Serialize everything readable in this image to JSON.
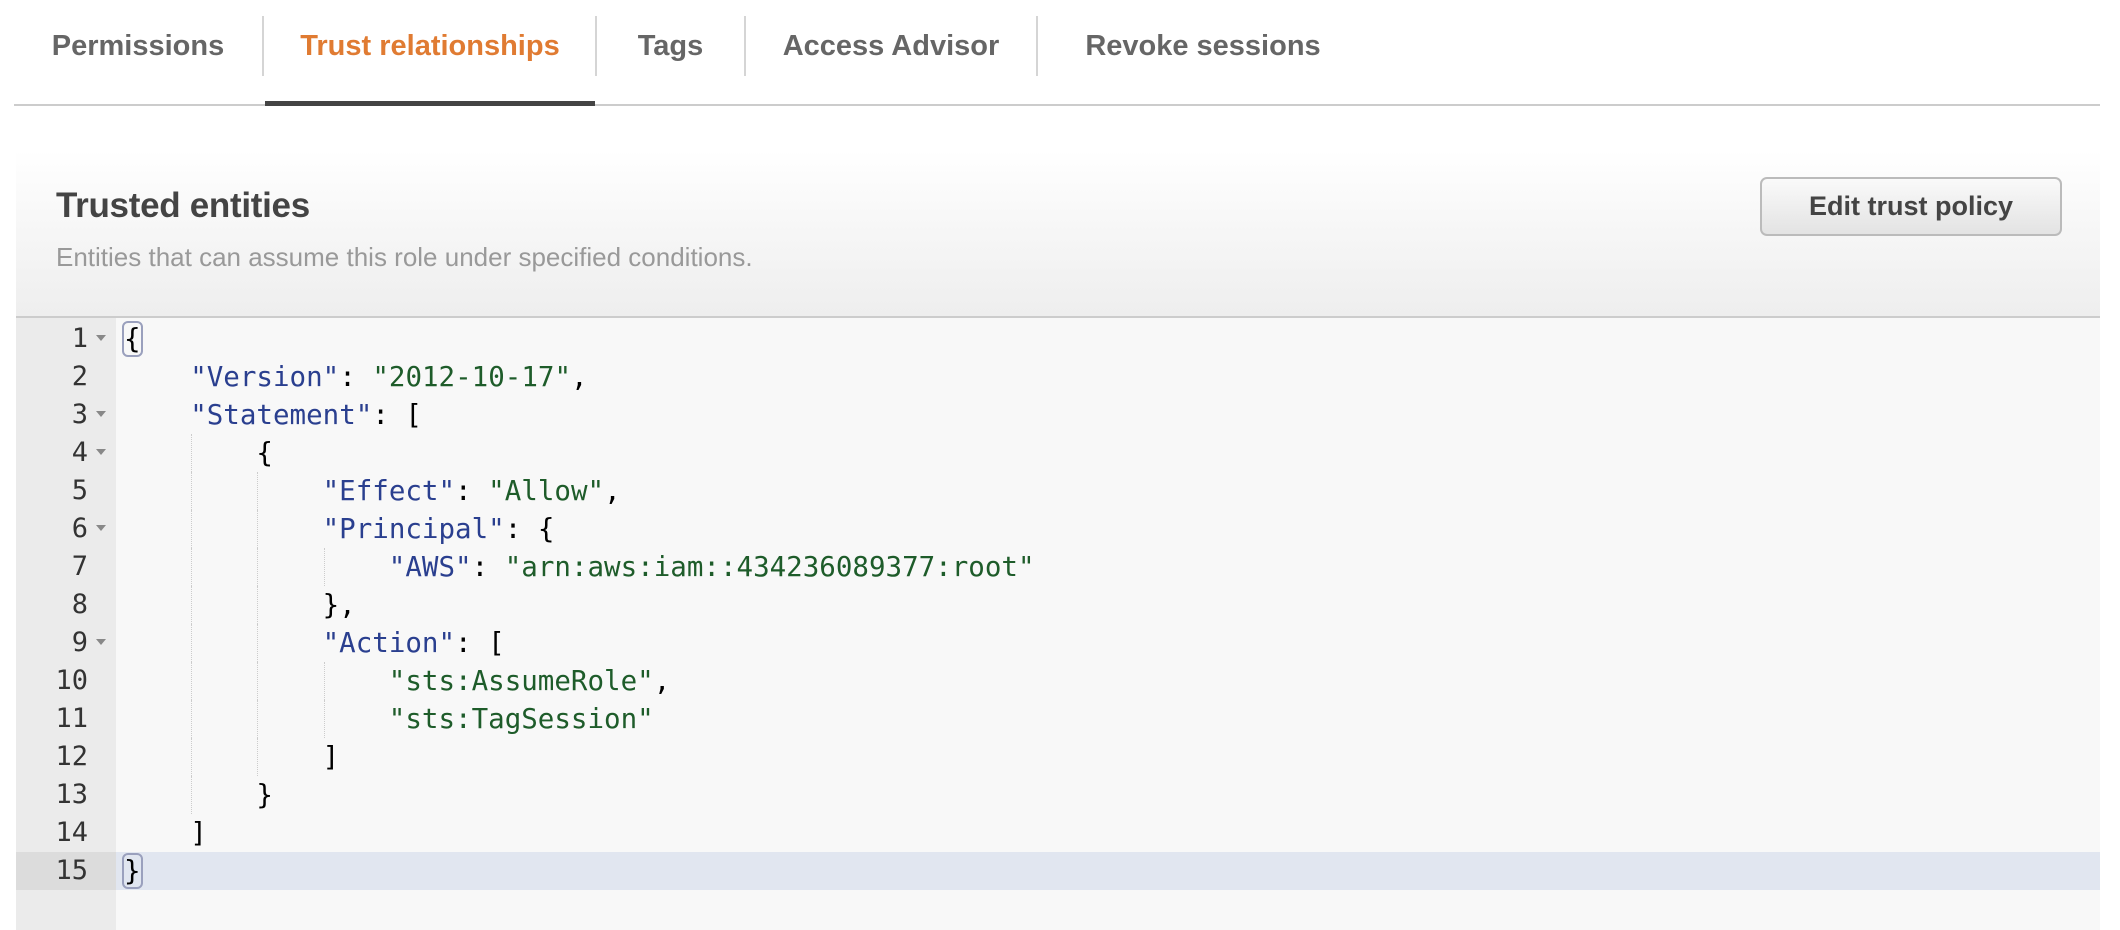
{
  "tabs": [
    {
      "label": "Permissions",
      "active": false
    },
    {
      "label": "Trust relationships",
      "active": true
    },
    {
      "label": "Tags",
      "active": false
    },
    {
      "label": "Access Advisor",
      "active": false
    },
    {
      "label": "Revoke sessions",
      "active": false
    }
  ],
  "panel": {
    "title": "Trusted entities",
    "subtitle": "Entities that can assume this role under specified conditions.",
    "edit_button": "Edit trust policy"
  },
  "colors": {
    "active_tab": "#e07b32",
    "json_key": "#2a3f8f",
    "json_string": "#1e5c2a",
    "active_line": "#e1e6f0"
  },
  "editor": {
    "active_line": 15,
    "lines": [
      {
        "n": "1",
        "fold": true,
        "indent": 0,
        "tokens": [
          {
            "t": "p",
            "v": "{",
            "hl": true
          }
        ]
      },
      {
        "n": "2",
        "fold": false,
        "indent": 1,
        "tokens": [
          {
            "t": "k",
            "v": "\"Version\""
          },
          {
            "t": "p",
            "v": ": "
          },
          {
            "t": "s",
            "v": "\"2012-10-17\""
          },
          {
            "t": "p",
            "v": ","
          }
        ]
      },
      {
        "n": "3",
        "fold": true,
        "indent": 1,
        "tokens": [
          {
            "t": "k",
            "v": "\"Statement\""
          },
          {
            "t": "p",
            "v": ": ["
          }
        ]
      },
      {
        "n": "4",
        "fold": true,
        "indent": 2,
        "tokens": [
          {
            "t": "p",
            "v": "{"
          }
        ]
      },
      {
        "n": "5",
        "fold": false,
        "indent": 3,
        "tokens": [
          {
            "t": "k",
            "v": "\"Effect\""
          },
          {
            "t": "p",
            "v": ": "
          },
          {
            "t": "s",
            "v": "\"Allow\""
          },
          {
            "t": "p",
            "v": ","
          }
        ]
      },
      {
        "n": "6",
        "fold": true,
        "indent": 3,
        "tokens": [
          {
            "t": "k",
            "v": "\"Principal\""
          },
          {
            "t": "p",
            "v": ": {"
          }
        ]
      },
      {
        "n": "7",
        "fold": false,
        "indent": 4,
        "tokens": [
          {
            "t": "k",
            "v": "\"AWS\""
          },
          {
            "t": "p",
            "v": ": "
          },
          {
            "t": "s",
            "v": "\"arn:aws:iam::434236089377:root\""
          }
        ]
      },
      {
        "n": "8",
        "fold": false,
        "indent": 3,
        "tokens": [
          {
            "t": "p",
            "v": "},"
          }
        ]
      },
      {
        "n": "9",
        "fold": true,
        "indent": 3,
        "tokens": [
          {
            "t": "k",
            "v": "\"Action\""
          },
          {
            "t": "p",
            "v": ": ["
          }
        ]
      },
      {
        "n": "10",
        "fold": false,
        "indent": 4,
        "tokens": [
          {
            "t": "s",
            "v": "\"sts:AssumeRole\""
          },
          {
            "t": "p",
            "v": ","
          }
        ]
      },
      {
        "n": "11",
        "fold": false,
        "indent": 4,
        "tokens": [
          {
            "t": "s",
            "v": "\"sts:TagSession\""
          }
        ]
      },
      {
        "n": "12",
        "fold": false,
        "indent": 3,
        "tokens": [
          {
            "t": "p",
            "v": "]"
          }
        ]
      },
      {
        "n": "13",
        "fold": false,
        "indent": 2,
        "tokens": [
          {
            "t": "p",
            "v": "}"
          }
        ]
      },
      {
        "n": "14",
        "fold": false,
        "indent": 1,
        "tokens": [
          {
            "t": "p",
            "v": "]"
          }
        ]
      },
      {
        "n": "15",
        "fold": false,
        "indent": 0,
        "tokens": [
          {
            "t": "p",
            "v": "}",
            "hl": true
          }
        ]
      }
    ]
  }
}
